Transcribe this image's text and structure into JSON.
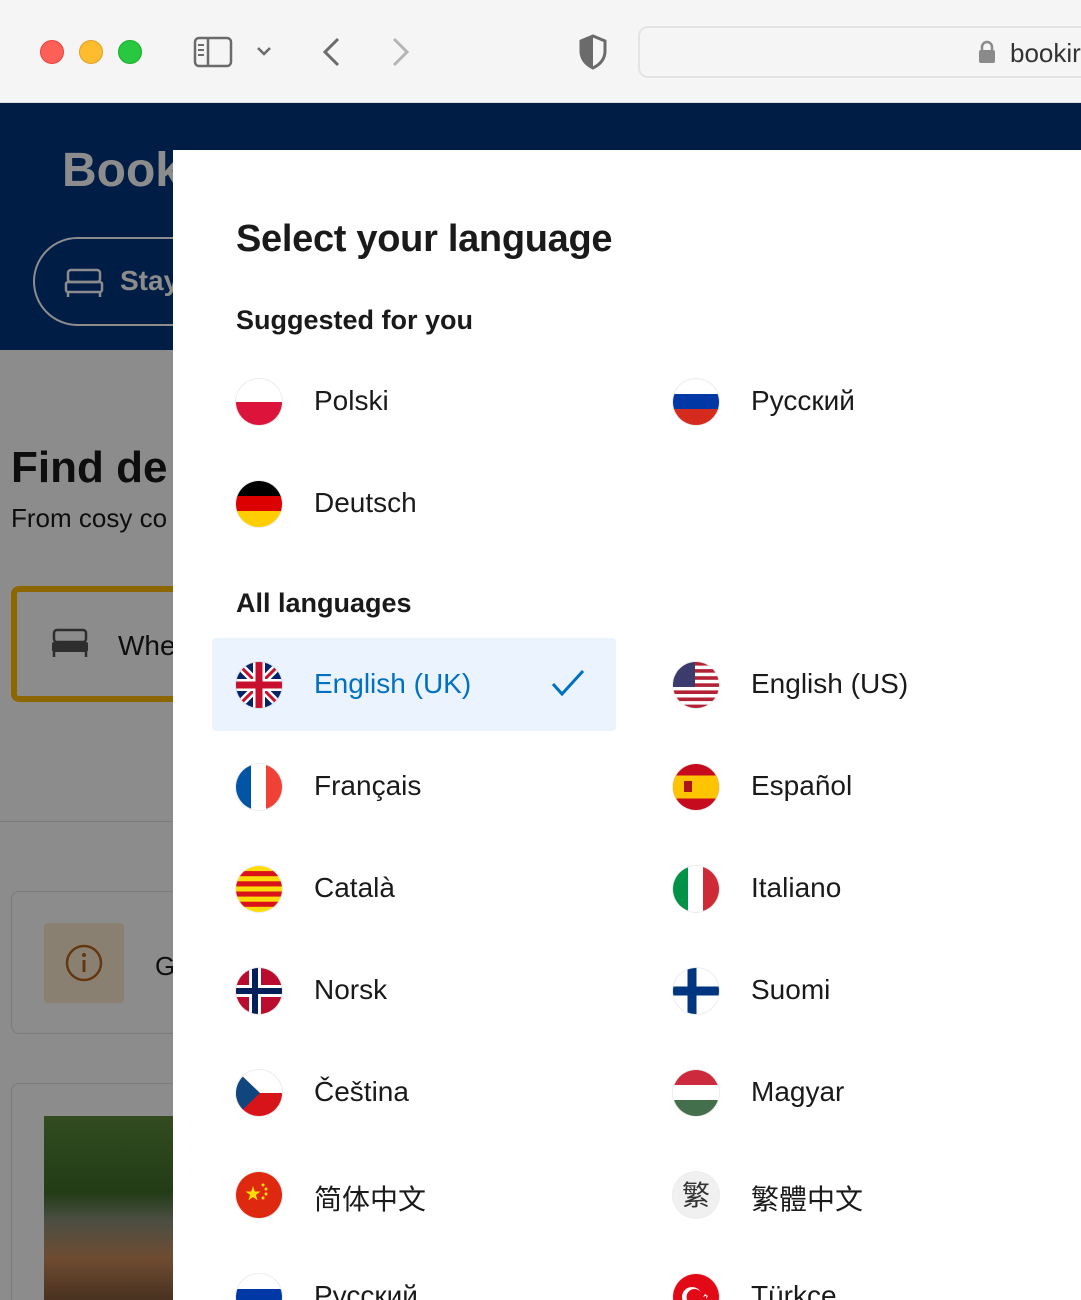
{
  "browser": {
    "url": "bookir",
    "colors": {
      "red": "#fe5f57",
      "yellow": "#febc2e",
      "green": "#28c840"
    }
  },
  "background_page": {
    "logo": "Book",
    "nav_pill_label": "Stay",
    "headline": "Find de",
    "subline": "From cosy co",
    "search_placeholder": "Whe",
    "info_text": "G"
  },
  "modal": {
    "title": "Select your language",
    "suggested_title": "Suggested for you",
    "all_title": "All languages",
    "suggested": [
      {
        "label": "Polski",
        "flag": "pl"
      },
      {
        "label": "Русский",
        "flag": "ru"
      },
      {
        "label": "Deutsch",
        "flag": "de"
      }
    ],
    "all": [
      {
        "label": "English (UK)",
        "flag": "gb",
        "selected": true
      },
      {
        "label": "English (US)",
        "flag": "us"
      },
      {
        "label": "Français",
        "flag": "fr"
      },
      {
        "label": "Español",
        "flag": "es"
      },
      {
        "label": "Català",
        "flag": "ca"
      },
      {
        "label": "Italiano",
        "flag": "it"
      },
      {
        "label": "Norsk",
        "flag": "no"
      },
      {
        "label": "Suomi",
        "flag": "fi"
      },
      {
        "label": "Čeština",
        "flag": "cz"
      },
      {
        "label": "Magyar",
        "flag": "hu"
      },
      {
        "label": "简体中文",
        "flag": "cn"
      },
      {
        "label": "繁體中文",
        "flag": "tw-char"
      },
      {
        "label": "Русский",
        "flag": "ru"
      },
      {
        "label": "Türkçe",
        "flag": "tr"
      }
    ],
    "accent": "#0071c2"
  }
}
